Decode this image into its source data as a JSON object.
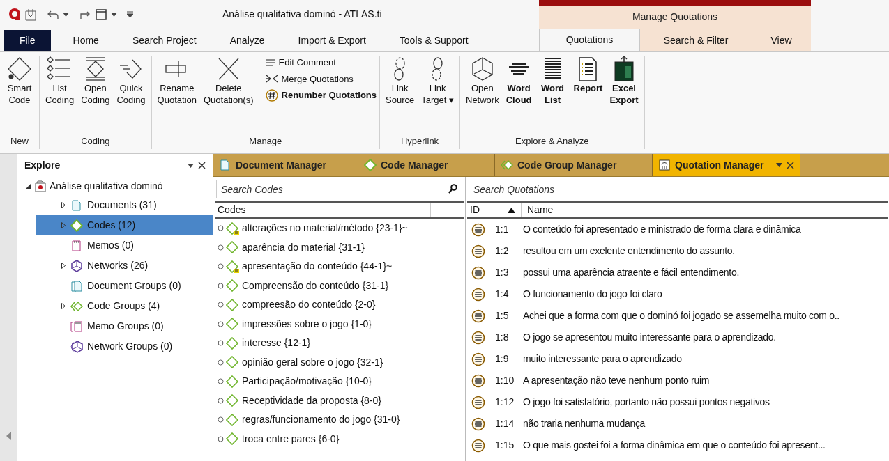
{
  "window": {
    "title": "Análise qualitativa dominó - ATLAS.ti"
  },
  "ribbon_tabs": [
    {
      "label": "File",
      "kind": "file"
    },
    {
      "label": "Home",
      "kind": "normal"
    },
    {
      "label": "Search Project",
      "kind": "normal"
    },
    {
      "label": "Analyze",
      "kind": "normal"
    },
    {
      "label": "Import & Export",
      "kind": "normal"
    },
    {
      "label": "Tools & Support",
      "kind": "normal"
    }
  ],
  "context_group": {
    "title": "Manage Quotations",
    "tabs": [
      {
        "label": "Quotations",
        "selected": true
      },
      {
        "label": "Search & Filter",
        "selected": false
      },
      {
        "label": "View",
        "selected": false
      }
    ]
  },
  "ribbon_groups": [
    {
      "label": "New",
      "items": [
        {
          "kind": "smart",
          "lines": [
            "Smart",
            "Code"
          ],
          "bold": false
        }
      ]
    },
    {
      "label": "Coding",
      "items": [
        {
          "kind": "list",
          "lines": [
            "List",
            "Coding"
          ],
          "bold": false
        },
        {
          "kind": "open",
          "lines": [
            "Open",
            "Coding"
          ],
          "bold": false
        },
        {
          "kind": "quick",
          "lines": [
            "Quick",
            "Coding"
          ],
          "bold": false
        }
      ]
    },
    {
      "label": "Manage",
      "items": [
        {
          "kind": "rename",
          "lines": [
            "Rename",
            "Quotation"
          ],
          "bold": false
        },
        {
          "kind": "delete",
          "lines": [
            "Delete",
            "Quotation(s)"
          ],
          "bold": false
        }
      ],
      "small_items": [
        {
          "kind": "comment",
          "label": "Edit Comment",
          "bold": false
        },
        {
          "kind": "merge",
          "label": "Merge Quotations",
          "bold": false
        },
        {
          "kind": "renumber",
          "label": "Renumber Quotations",
          "bold": true
        }
      ]
    },
    {
      "label": "Hyperlink",
      "items": [
        {
          "kind": "link_source",
          "lines": [
            "Link",
            "Source"
          ],
          "bold": false
        },
        {
          "kind": "link_target",
          "lines": [
            "Link",
            "Target ▾"
          ],
          "bold": false
        }
      ]
    },
    {
      "label": "Explore & Analyze",
      "items": [
        {
          "kind": "network",
          "lines": [
            "Open",
            "Network"
          ],
          "bold": false
        },
        {
          "kind": "cloud",
          "lines": [
            "Word",
            "Cloud"
          ],
          "bold": true
        },
        {
          "kind": "wordlist",
          "lines": [
            "Word",
            "List"
          ],
          "bold": true
        },
        {
          "kind": "report",
          "lines": [
            "Report"
          ],
          "bold": true
        },
        {
          "kind": "excel",
          "lines": [
            "Excel",
            "Export"
          ],
          "bold": true
        }
      ]
    }
  ],
  "explore": {
    "title": "Explore",
    "root": {
      "label": "Análise qualitativa dominó",
      "expanded": true,
      "children": [
        {
          "label": "Documents (31)",
          "kind": "documents",
          "expandable": true,
          "selected": false
        },
        {
          "label": "Codes (12)",
          "kind": "codes",
          "expandable": true,
          "selected": true
        },
        {
          "label": "Memos (0)",
          "kind": "memos",
          "expandable": false,
          "selected": false
        },
        {
          "label": "Networks (26)",
          "kind": "networks",
          "expandable": true,
          "selected": false
        },
        {
          "label": "Document Groups (0)",
          "kind": "document_groups",
          "expandable": false,
          "selected": false
        },
        {
          "label": "Code Groups (4)",
          "kind": "code_groups",
          "expandable": true,
          "selected": false
        },
        {
          "label": "Memo Groups (0)",
          "kind": "memo_groups",
          "expandable": false,
          "selected": false
        },
        {
          "label": "Network Groups (0)",
          "kind": "network_groups",
          "expandable": false,
          "selected": false
        }
      ]
    }
  },
  "manager_tabs": [
    {
      "label": "Document Manager",
      "kind": "documents",
      "selected": false
    },
    {
      "label": "Code Manager",
      "kind": "codes",
      "selected": false
    },
    {
      "label": "Code Group Manager",
      "kind": "code_groups",
      "selected": false
    },
    {
      "label": "Quotation Manager",
      "kind": "quotations",
      "selected": true
    }
  ],
  "codes_pane": {
    "search": {
      "placeholder": "Search Codes"
    },
    "column": "Codes",
    "rows": [
      {
        "label": "alterações no material/método {23-1}~",
        "has_comment": true
      },
      {
        "label": "aparência do material {31-1}",
        "has_comment": false
      },
      {
        "label": "apresentação do conteúdo {44-1}~",
        "has_comment": true
      },
      {
        "label": "Compreensão do conteúdo {31-1}",
        "has_comment": false
      },
      {
        "label": "compreesão do conteúdo {2-0}",
        "has_comment": false
      },
      {
        "label": "impressões sobre o jogo {1-0}",
        "has_comment": false
      },
      {
        "label": "interesse {12-1}",
        "has_comment": false
      },
      {
        "label": "opinião geral sobre o jogo {32-1}",
        "has_comment": false
      },
      {
        "label": "Participação/motivação {10-0}",
        "has_comment": false
      },
      {
        "label": "Receptividade da proposta {8-0}",
        "has_comment": false
      },
      {
        "label": "regras/funcionamento do jogo {31-0}",
        "has_comment": false
      },
      {
        "label": "troca entre pares {6-0}",
        "has_comment": false
      }
    ]
  },
  "quotations_pane": {
    "search": {
      "placeholder": "Search Quotations"
    },
    "columns": [
      "ID",
      "Name"
    ],
    "rows": [
      {
        "id": "1:1",
        "name": "O conteúdo foi apresentado e ministrado de forma clara e dinâmica"
      },
      {
        "id": "1:2",
        "name": "resultou em um  exelente entendimento do assunto."
      },
      {
        "id": "1:3",
        "name": "possui uma aparência atraente e fácil entendimento."
      },
      {
        "id": "1:4",
        "name": "O funcionamento do jogo foi claro"
      },
      {
        "id": "1:5",
        "name": "Achei que a forma com que o dominó foi jogado se assemelha muito com o.."
      },
      {
        "id": "1:8",
        "name": "O jogo se apresentou muito interessante para o aprendizado."
      },
      {
        "id": "1:9",
        "name": "muito interessante para o aprendizado"
      },
      {
        "id": "1:10",
        "name": "A apresentação não teve nenhum ponto ruim"
      },
      {
        "id": "1:12",
        "name": "O jogo foi satisfatório, portanto não possui pontos negativos"
      },
      {
        "id": "1:14",
        "name": "não  traria nenhuma mudança"
      },
      {
        "id": "1:15",
        "name": "O que mais gostei foi a forma dinâmica em  que o conteúdo foi apresent..."
      }
    ]
  }
}
